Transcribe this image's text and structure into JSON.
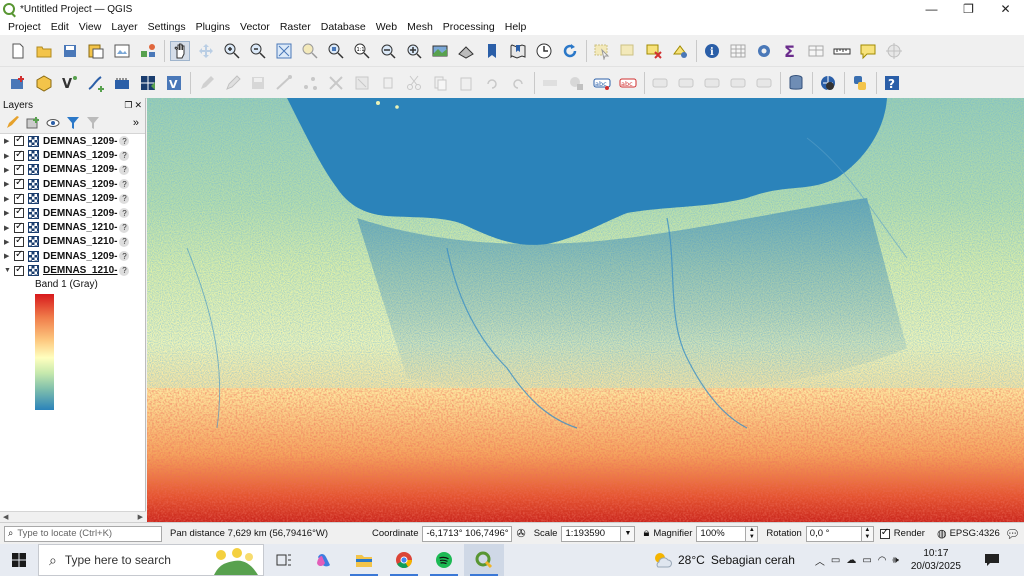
{
  "window": {
    "title": "*Untitled Project — QGIS",
    "minimize_glyph": "—",
    "maximize_glyph": "❐",
    "close_glyph": "✕"
  },
  "menu": [
    "Project",
    "Edit",
    "View",
    "Layer",
    "Settings",
    "Plugins",
    "Vector",
    "Raster",
    "Database",
    "Web",
    "Mesh",
    "Processing",
    "Help"
  ],
  "toolbar1_icons": [
    "new-project-icon",
    "open-project-icon",
    "save-project-icon",
    "save-as-icon",
    "print-layout-icon",
    "style-manager-icon",
    "pan-icon",
    "pan-to-selection-icon",
    "zoom-in-icon",
    "zoom-out-icon",
    "zoom-full-icon",
    "zoom-selection-icon",
    "zoom-layer-icon",
    "zoom-native-icon",
    "zoom-last-icon",
    "zoom-next-icon",
    "new-map-view-icon",
    "new-3d-view-icon",
    "bookmark-icon",
    "show-bookmarks-icon",
    "temporal-controller-icon",
    "refresh-icon",
    "select-features-icon",
    "select-by-value-icon",
    "deselect-icon",
    "select-location-icon",
    "identify-icon",
    "attribute-table-icon",
    "toolbox-icon",
    "statistics-icon",
    "open-table-icon",
    "measure-icon",
    "map-tips-icon",
    "coordinate-capture-icon"
  ],
  "toolbar2_icons": [
    "data-source-manager-icon",
    "new-geopackage-icon",
    "add-vector-icon",
    "digitize-icon",
    "new-memory-layer-icon",
    "add-raster-icon",
    "add-mesh-icon",
    "current-edits-icon",
    "toggle-editing-icon",
    "save-edits-icon",
    "add-feature-icon",
    "vertex-tool-icon",
    "modify-attributes-icon",
    "delete-selected-icon",
    "cut-icon",
    "copy-icon",
    "paste-icon",
    "undo-icon",
    "redo-icon",
    "label-icon",
    "pin-label-icon",
    "label-abc-icon",
    "label-red-icon",
    "show-labels-icon",
    "move-label-icon",
    "rotate-label-icon",
    "change-label-icon",
    "label-toolbar-icon",
    "db-manager-icon",
    "metasearch-icon",
    "python-icon",
    "help-icon"
  ],
  "layers_panel": {
    "title": "Layers",
    "layers": [
      {
        "name": "DEMNAS_1209-",
        "expanded": false,
        "selected": false
      },
      {
        "name": "DEMNAS_1209-",
        "expanded": false,
        "selected": false
      },
      {
        "name": "DEMNAS_1209-",
        "expanded": false,
        "selected": false
      },
      {
        "name": "DEMNAS_1209-",
        "expanded": false,
        "selected": false
      },
      {
        "name": "DEMNAS_1209-",
        "expanded": false,
        "selected": false
      },
      {
        "name": "DEMNAS_1209-",
        "expanded": false,
        "selected": false
      },
      {
        "name": "DEMNAS_1210-",
        "expanded": false,
        "selected": false
      },
      {
        "name": "DEMNAS_1210-",
        "expanded": false,
        "selected": false
      },
      {
        "name": "DEMNAS_1209-",
        "expanded": false,
        "selected": false
      },
      {
        "name": "DEMNAS_1210-",
        "expanded": true,
        "selected": true
      }
    ],
    "band_label": "Band 1 (Gray)",
    "ramp_colors": [
      "#d7191c",
      "#fdae61",
      "#ffffbf",
      "#abdda4",
      "#2b83ba"
    ]
  },
  "statusbar": {
    "locate_placeholder": "Type to locate (Ctrl+K)",
    "message": "Pan distance 7,629 km (56,79416°W)",
    "coordinate_label": "Coordinate",
    "coordinate_value": "-6,1713° 106,7496°",
    "scale_label": "Scale",
    "scale_value": "1:193590",
    "magnifier_label": "Magnifier",
    "magnifier_value": "100%",
    "rotation_label": "Rotation",
    "rotation_value": "0,0 °",
    "render_label": "Render",
    "crs": "EPSG:4326"
  },
  "taskbar": {
    "search_placeholder": "Type here to search",
    "weather_temp": "28°C",
    "weather_text": "Sebagian cerah",
    "time": "10:17",
    "date": "20/03/2025"
  }
}
